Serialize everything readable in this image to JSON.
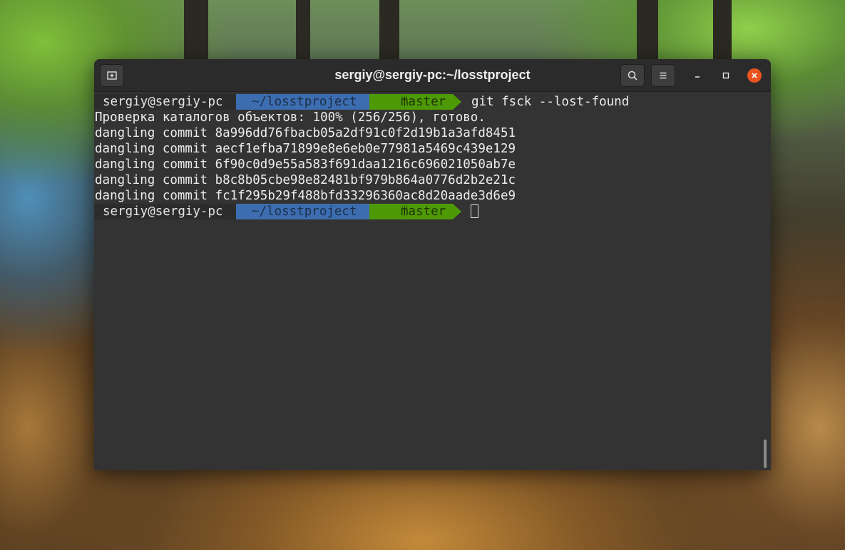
{
  "window": {
    "title": "sergiy@sergiy-pc:~/losstproject"
  },
  "icons": {
    "new_tab": "new-tab-icon",
    "search": "search-icon",
    "menu": "hamburger-menu-icon",
    "minimize": "minimize-icon",
    "maximize": "maximize-icon",
    "close": "close-icon",
    "branch": "git-branch-icon"
  },
  "colors": {
    "dir_segment": "#3c6db0",
    "git_segment": "#4e9a06",
    "close_button": "#e9541f",
    "terminal_bg": "#333333"
  },
  "prompt": {
    "user_host": "sergiy@sergiy-pc",
    "directory": "~/losstproject",
    "branch_glyph": "ᛘ",
    "branch": "master"
  },
  "terminal": {
    "command": "git fsck --lost-found",
    "output": [
      "Проверка каталогов объектов: 100% (256/256), готово.",
      "dangling commit 8a996dd76fbacb05a2df91c0f2d19b1a3afd8451",
      "dangling commit aecf1efba71899e8e6eb0e77981a5469c439e129",
      "dangling commit 6f90c0d9e55a583f691daa1216c696021050ab7e",
      "dangling commit b8c8b05cbe98e82481bf979b864a0776d2b2e21c",
      "dangling commit fc1f295b29f488bfd33296360ac8d20aade3d6e9"
    ]
  }
}
